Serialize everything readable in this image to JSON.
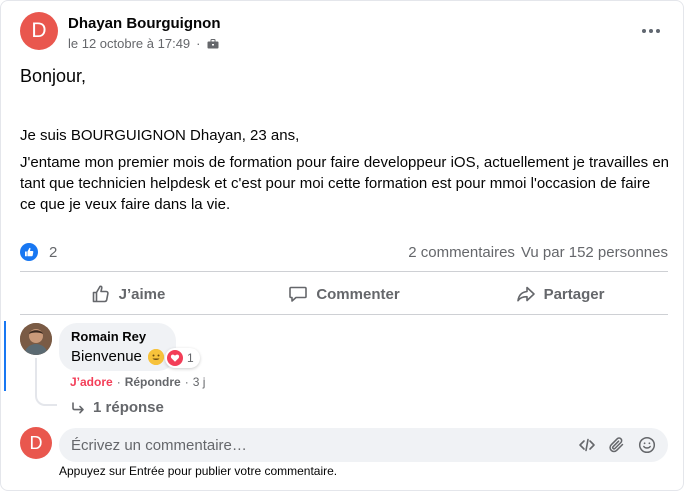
{
  "post": {
    "avatar_letter": "D",
    "author": "Dhayan Bourguignon",
    "timestamp": "le 12 octobre à 17:49",
    "audience_icon": "briefcase-icon",
    "greeting": "Bonjour,",
    "line1": "Je suis BOURGUIGNON Dhayan, 23 ans,",
    "paragraph": "J'entame mon premier mois de formation pour faire developpeur iOS, actuellement je travailles en tant que technicien helpdesk et c'est pour moi cette formation est pour mmoi l'occasion de faire ce que je veux faire dans la vie."
  },
  "stats": {
    "likes": "2",
    "comments": "2 commentaires",
    "views": "Vu par 152 personnes"
  },
  "actions": {
    "like": "J’aime",
    "comment": "Commenter",
    "share": "Partager"
  },
  "comment": {
    "author": "Romain Rey",
    "text": "Bienvenue",
    "reaction_count": "1",
    "adore": "J’adore",
    "reply": "Répondre",
    "separator": "·",
    "age": "3 j",
    "replies": "1 réponse"
  },
  "composer": {
    "avatar_letter": "D",
    "placeholder": "Écrivez un commentaire…",
    "hint": "Appuyez sur Entrée pour publier votre commentaire."
  },
  "colors": {
    "brand_blue": "#1877f2",
    "avatar_red": "#e9574e",
    "love_red": "#f33e58",
    "muted": "#65676b"
  }
}
